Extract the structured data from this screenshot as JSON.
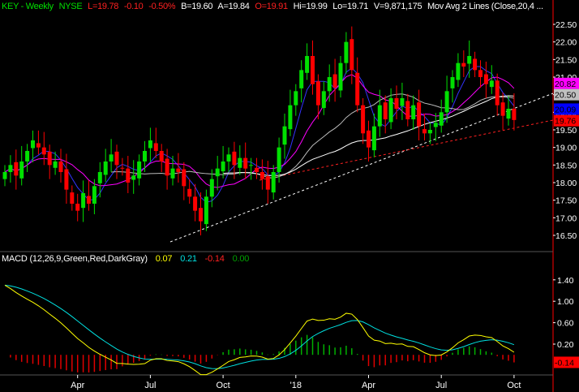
{
  "header": {
    "symbol": "KEY - Weekly",
    "exchange": "NYSE",
    "last": "L=19.78",
    "change": "-0.10",
    "pct": "-0.50%",
    "bid": "B=19.60",
    "ask": "A=19.84",
    "open": "O=19.91",
    "high": "Hi=19.99",
    "low": "Lo=19.71",
    "volume": "V=9,871,175",
    "study": "Mov Avg 2 Lines (Close,20,4 ..."
  },
  "macd_header": {
    "label": "MACD (12,26,9,Green,Red,DarkGray)",
    "macd": "0.07",
    "signal": "0.21",
    "hist": "-0.14",
    "zero": "0.00"
  },
  "colors": {
    "up": "#00e000",
    "down": "#ff0000",
    "ma_fast": "#3333ff",
    "ma_mid": "#ff00ff",
    "ma_slow": "#ffffff",
    "ma_gray": "#bbbbbb",
    "macd": "#ffff00",
    "signal": "#00e0e0"
  },
  "chart_data": {
    "type": "candlestick",
    "price_ticks": [
      "22.50",
      "22.00",
      "21.50",
      "21.00",
      "20.50",
      "20.00",
      "19.50",
      "19.00",
      "18.50",
      "18.00",
      "17.50",
      "17.00",
      "16.50"
    ],
    "price_labels": [
      {
        "text": "20.82",
        "value": 20.82,
        "bg": "#ff00ff"
      },
      {
        "text": "20.50",
        "value": 20.5,
        "bg": "#c0c0c0"
      },
      {
        "text": "20.09",
        "value": 20.09,
        "bg": "#0000ff"
      },
      {
        "text": "19.76",
        "value": 19.76,
        "bg": "#ff0000"
      }
    ],
    "x_labels": [
      {
        "text": "Apr",
        "week": 13
      },
      {
        "text": "Jul",
        "week": 26
      },
      {
        "text": "Oct",
        "week": 39
      },
      {
        "text": "'18",
        "week": 52
      },
      {
        "text": "Apr",
        "week": 65
      },
      {
        "text": "Jul",
        "week": 78
      },
      {
        "text": "Oct",
        "week": 91
      }
    ],
    "macd_ticks": [
      "1.40",
      "1.00",
      "0.60",
      "0.20"
    ],
    "macd_last_label": "-0.14",
    "closes": [
      18.3,
      18.5,
      18.2,
      18.6,
      18.9,
      19.2,
      19.0,
      18.8,
      18.5,
      18.6,
      18.3,
      17.8,
      17.4,
      17.2,
      17.7,
      17.4,
      17.9,
      18.3,
      18.6,
      18.8,
      18.5,
      18.4,
      18.0,
      18.2,
      18.6,
      18.9,
      19.2,
      18.9,
      18.6,
      18.2,
      18.4,
      18.3,
      17.9,
      17.6,
      17.2,
      16.9,
      17.6,
      18.1,
      18.4,
      18.6,
      18.8,
      18.5,
      18.7,
      18.4,
      18.5,
      18.3,
      18.1,
      17.8,
      18.3,
      19.0,
      19.6,
      20.2,
      20.6,
      21.2,
      21.6,
      20.8,
      20.2,
      20.6,
      21.0,
      20.7,
      21.4,
      22.0,
      21.2,
      20.2,
      19.4,
      19.0,
      19.6,
      20.2,
      19.8,
      20.4,
      20.1,
      20.4,
      19.8,
      20.2,
      19.6,
      19.4,
      19.5,
      19.7,
      20.0,
      20.6,
      21.0,
      21.4,
      21.3,
      21.6,
      21.2,
      21.0,
      20.8,
      20.9,
      20.2,
      19.9,
      20.1,
      19.78
    ],
    "ma_periods": [
      5,
      10,
      20,
      40
    ]
  }
}
